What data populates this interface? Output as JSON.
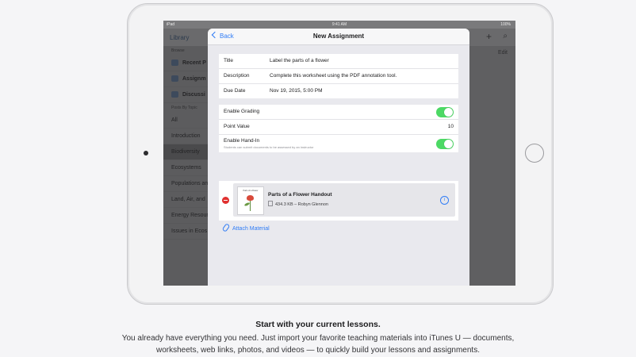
{
  "device": {
    "statusbar": {
      "carrier": "iPad",
      "time": "9:41 AM",
      "battery": "100%"
    }
  },
  "background_app": {
    "nav_label": "Library",
    "edit_label": "Edit",
    "sidebar": {
      "browse_header": "Browse",
      "browse_items": [
        "Recent P",
        "Assignm",
        "Discussi"
      ],
      "posts_header": "Posts By Topic",
      "topic_items": [
        "All",
        "Introduction",
        "Biodiversity",
        "Ecosystems",
        "Populations an",
        "Land, Air, and",
        "Energy Resour",
        "Issues in Ecos"
      ],
      "selected_topic": "Biodiversity"
    }
  },
  "modal": {
    "back_label": "Back",
    "title": "New Assignment",
    "fields": [
      {
        "label": "Title",
        "value": "Label the parts of a flower"
      },
      {
        "label": "Description",
        "value": "Complete this worksheet using the PDF annotation tool."
      },
      {
        "label": "Due Date",
        "value": "Nov 19, 2015, 5:00 PM"
      }
    ],
    "grading": {
      "enable_grading_label": "Enable Grading",
      "enable_grading_on": true,
      "point_value_label": "Point Value",
      "point_value": "10",
      "enable_handin_label": "Enable Hand-In",
      "enable_handin_sub": "Students can submit documents to be assessed by an instructor",
      "enable_handin_on": true
    },
    "material": {
      "name": "Parts of a Flower Handout",
      "meta": "434.3 KB – Robyn Glennon",
      "thumb_title": "Parts of a Flower"
    },
    "attach_label": "Attach Material"
  },
  "caption": {
    "title": "Start with your current lessons.",
    "body": "You already have everything you need. Just import your favorite teaching materials into iTunes U — documents, worksheets, web links, photos, and videos — to quickly build your lessons and assignments."
  },
  "colors": {
    "accent": "#2f7cf6",
    "toggle_on": "#4cd964",
    "remove": "#e0302f"
  },
  "icons": [
    "back-chevron-icon",
    "plus-icon",
    "search-icon",
    "info-icon",
    "paperclip-icon",
    "remove-icon",
    "document-icon"
  ]
}
